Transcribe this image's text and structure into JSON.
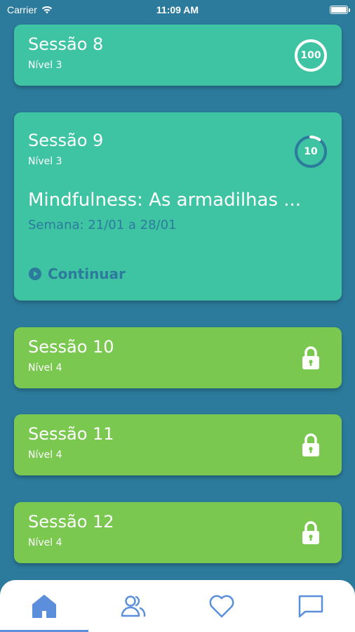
{
  "status_bar": {
    "carrier": "Carrier",
    "time": "11:09 AM"
  },
  "sessions": [
    {
      "title": "Sessão 8",
      "level": "Nível 3",
      "progress": 100,
      "progress_label": "100",
      "state": "completed"
    },
    {
      "title": "Sessão 9",
      "level": "Nível 3",
      "progress": 10,
      "progress_label": "10",
      "state": "current",
      "description": "Mindfulness: As armadilhas ...",
      "week": "Semana: 21/01 a 28/01",
      "continue_label": "Continuar"
    },
    {
      "title": "Sessão 10",
      "level": "Nível 4",
      "state": "locked"
    },
    {
      "title": "Sessão 11",
      "level": "Nível 4",
      "state": "locked"
    },
    {
      "title": "Sessão 12",
      "level": "Nível 4",
      "state": "locked"
    }
  ],
  "tab_bar": {
    "tabs": [
      {
        "icon": "home-icon",
        "active": true
      },
      {
        "icon": "users-icon",
        "active": false
      },
      {
        "icon": "heart-icon",
        "active": false
      },
      {
        "icon": "chat-icon",
        "active": false
      }
    ]
  },
  "colors": {
    "background": "#2c7b9c",
    "teal_card": "#3ec4a3",
    "green_card": "#7ac850",
    "tab_accent": "#5b8fdb"
  }
}
